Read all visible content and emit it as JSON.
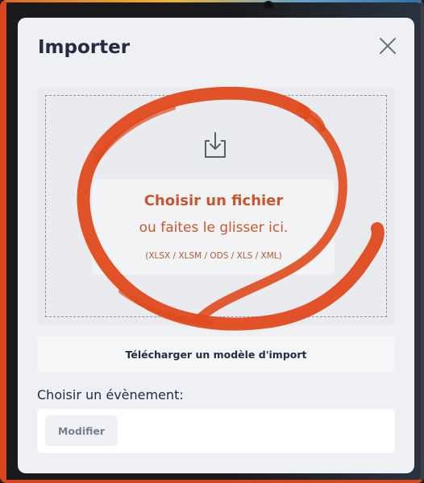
{
  "modal": {
    "title": "Importer",
    "close_icon": "close-icon"
  },
  "dropzone": {
    "icon": "download-tray-icon",
    "choose_file": "Choisir un fichier",
    "or_drag": "ou faites le glisser ici.",
    "formats": "(XLSX / XLSM / ODS / XLS / XML)"
  },
  "template_button": {
    "label": "Télécharger un modèle d'import"
  },
  "event": {
    "label": "Choisir un évènement:",
    "modify_label": "Modifier"
  },
  "colors": {
    "accent": "#c8572f",
    "annotation": "#e04a1c",
    "text_dark": "#252b41",
    "modal_bg": "#eef0f4"
  },
  "annotation": {
    "shape": "hand-drawn-circle"
  }
}
